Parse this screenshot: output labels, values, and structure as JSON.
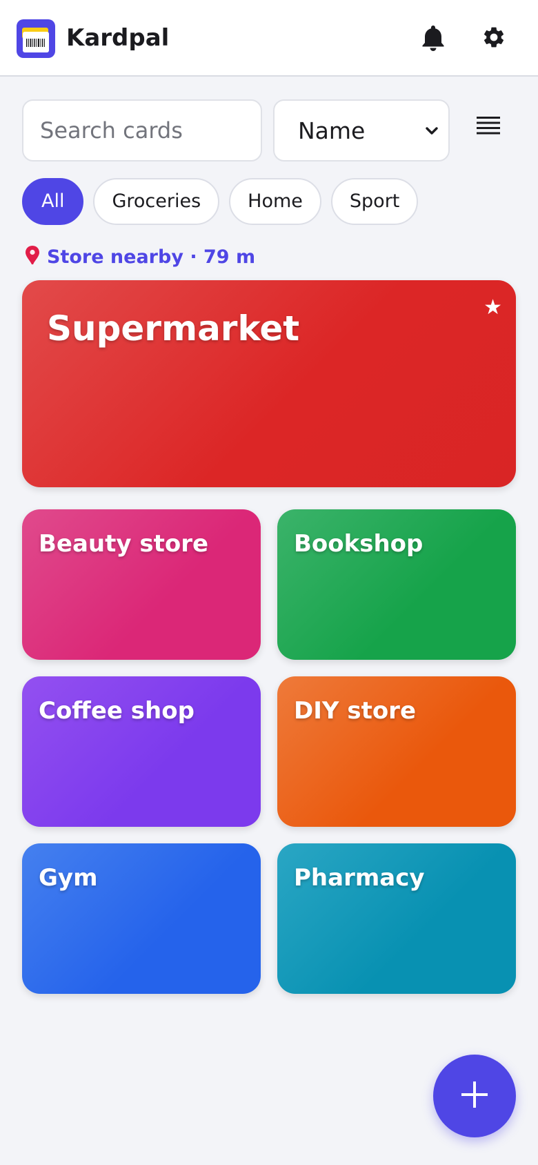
{
  "app": {
    "title": "Kardpal",
    "logo_icon": "wallet-card-icon"
  },
  "header": {
    "notifications_icon": "bell-icon",
    "settings_icon": "gear-icon"
  },
  "controls": {
    "search_placeholder": "Search cards",
    "search_value": "",
    "sort_selected": "Name",
    "view_toggle_icon": "list-view-icon"
  },
  "filters": {
    "chips": [
      {
        "label": "All",
        "active": true
      },
      {
        "label": "Groceries",
        "active": false
      },
      {
        "label": "Home",
        "active": false
      },
      {
        "label": "Sport",
        "active": false
      }
    ]
  },
  "nearby": {
    "icon": "map-pin-icon",
    "text": "Store nearby · 79 m"
  },
  "cards": {
    "featured": {
      "name": "Supermarket",
      "favorite": true,
      "color": "#dc2626"
    },
    "grid": [
      {
        "name": "Beauty store",
        "color": "#db2777"
      },
      {
        "name": "Bookshop",
        "color": "#16a34a"
      },
      {
        "name": "Coffee shop",
        "color": "#7c3aed"
      },
      {
        "name": "DIY store",
        "color": "#ea580c"
      },
      {
        "name": "Gym",
        "color": "#2563eb"
      },
      {
        "name": "Pharmacy",
        "color": "#0891b2"
      }
    ]
  },
  "fab": {
    "icon": "plus-icon"
  },
  "theme": {
    "accent": "#4f46e5",
    "background": "#f3f4f8"
  }
}
